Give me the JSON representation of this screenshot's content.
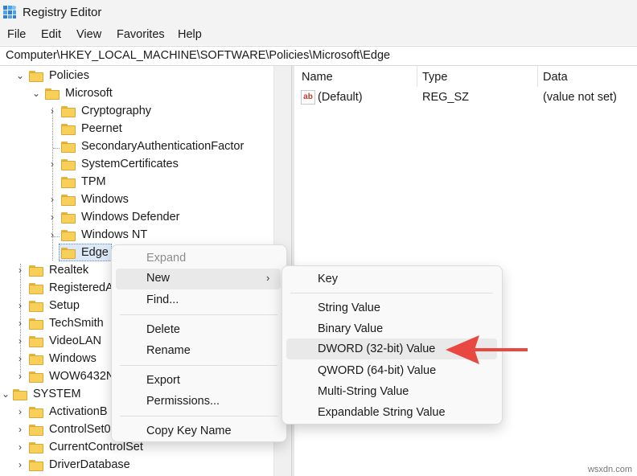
{
  "window": {
    "title": "Registry Editor"
  },
  "menu": [
    "File",
    "Edit",
    "View",
    "Favorites",
    "Help"
  ],
  "address": "Computer\\HKEY_LOCAL_MACHINE\\SOFTWARE\\Policies\\Microsoft\\Edge",
  "tree": {
    "policies": "Policies",
    "microsoft": "Microsoft",
    "cryptography": "Cryptography",
    "peernet": "Peernet",
    "secondary_auth": "SecondaryAuthenticationFactor",
    "system_certificates": "SystemCertificates",
    "tpm": "TPM",
    "windows": "Windows",
    "windows_defender": "Windows Defender",
    "windows_nt": "Windows NT",
    "edge": "Edge",
    "realtek": "Realtek",
    "registered": "RegisteredA",
    "setup": "Setup",
    "techsmith": "TechSmith",
    "videolan": "VideoLAN",
    "windows2": "Windows",
    "wow": "WOW6432N",
    "system": "SYSTEM",
    "activation": "ActivationB",
    "controlset": "ControlSet0",
    "current_control_set": "CurrentControlSet",
    "driver_database": "DriverDatabase"
  },
  "list": {
    "headers": {
      "name": "Name",
      "type": "Type",
      "data": "Data"
    },
    "rows": [
      {
        "name": "(Default)",
        "type": "REG_SZ",
        "data": "(value not set)"
      }
    ]
  },
  "context_menu": {
    "expand": "Expand",
    "new": "New",
    "find": "Find...",
    "delete": "Delete",
    "rename": "Rename",
    "export": "Export",
    "permissions": "Permissions...",
    "copy_key_name": "Copy Key Name"
  },
  "submenu": {
    "key": "Key",
    "string": "String Value",
    "binary": "Binary Value",
    "dword": "DWORD (32-bit) Value",
    "qword": "QWORD (64-bit) Value",
    "multi": "Multi-String Value",
    "expandable": "Expandable String Value"
  },
  "watermark": "wsxdn.com",
  "colors": {
    "folder": "#f7cf59",
    "arrow": "#e8483f",
    "selection": "#dde9f7"
  },
  "icons": {
    "app": "registry-editor-icon",
    "folder": "folder-icon",
    "value": "string-value-icon"
  }
}
